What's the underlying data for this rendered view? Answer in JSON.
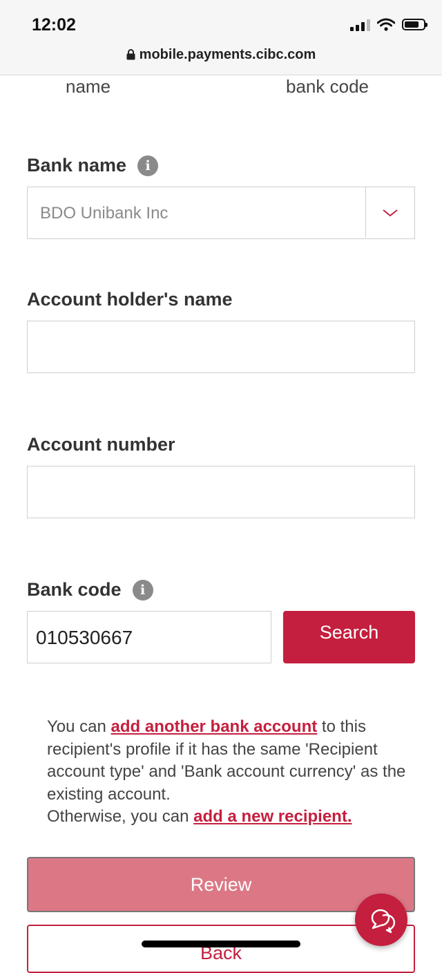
{
  "status_bar": {
    "time": "12:02",
    "url": "mobile.payments.cibc.com"
  },
  "column_fragments": {
    "left": "name",
    "right": "bank code"
  },
  "bank_name": {
    "label": "Bank name",
    "info": "i",
    "selected": "BDO Unibank Inc"
  },
  "account_holder": {
    "label": "Account holder's name",
    "value": ""
  },
  "account_number": {
    "label": "Account number",
    "value": ""
  },
  "bank_code": {
    "label": "Bank code",
    "info": "i",
    "value": "010530667",
    "search_label": "Search"
  },
  "note": {
    "part1": "You can ",
    "link1": "add another bank account",
    "part2": " to this recipient's profile if it has the same 'Recipient account type' and 'Bank account currency' as the existing account.",
    "part3": "Otherwise, you can ",
    "link2": "add a new recipient."
  },
  "actions": {
    "review_label": "Review",
    "back_label": "Back"
  },
  "colors": {
    "brand_red": "#c41f3e",
    "review_disabled": "#dc7886"
  },
  "icons": {
    "lock": "lock-icon",
    "signal": "signal-icon",
    "wifi": "wifi-icon",
    "battery": "battery-icon",
    "chevron": "chevron-down-icon",
    "chat": "chat-icon"
  }
}
